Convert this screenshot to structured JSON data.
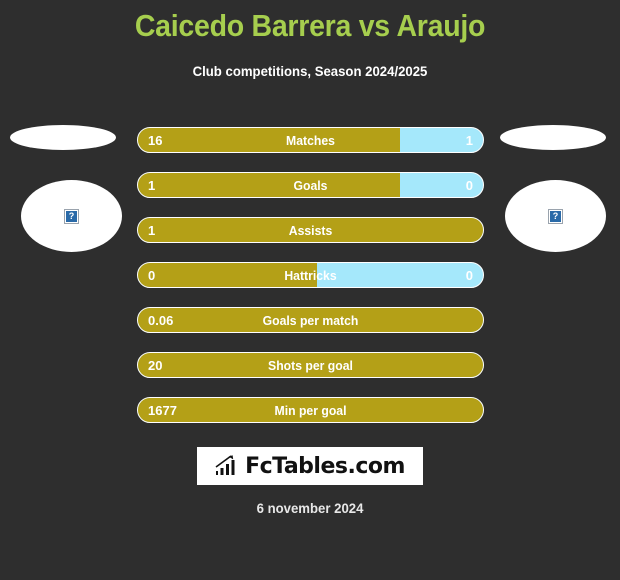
{
  "header": {
    "title": "Caicedo Barrera vs Araujo",
    "subtitle": "Club competitions, Season 2024/2025",
    "title_color": "#a6ce4e"
  },
  "players": {
    "left": {
      "photo_icon": "broken-image-icon",
      "photo_placeholder": "?",
      "flag_icon": "flag-placeholder"
    },
    "right": {
      "photo_icon": "broken-image-icon",
      "photo_placeholder": "?",
      "flag_icon": "flag-placeholder"
    }
  },
  "colors": {
    "background": "#2e2e2e",
    "home_bar": "#b4a017",
    "away_bar": "#a5e8fb",
    "accent": "#a6ce4e"
  },
  "stats": [
    {
      "label": "Matches",
      "home": "16",
      "away": "1",
      "home_pct": 76
    },
    {
      "label": "Goals",
      "home": "1",
      "away": "0",
      "home_pct": 76
    },
    {
      "label": "Assists",
      "home": "1",
      "away": "",
      "home_pct": 100
    },
    {
      "label": "Hattricks",
      "home": "0",
      "away": "0",
      "home_pct": 52
    },
    {
      "label": "Goals per match",
      "home": "0.06",
      "away": "",
      "home_pct": 100
    },
    {
      "label": "Shots per goal",
      "home": "20",
      "away": "",
      "home_pct": 100
    },
    {
      "label": "Min per goal",
      "home": "1677",
      "away": "",
      "home_pct": 100
    }
  ],
  "logo": {
    "text": "FcTables.com",
    "icon": "bar-chart-growth-icon"
  },
  "footer": {
    "date": "6 november 2024"
  }
}
